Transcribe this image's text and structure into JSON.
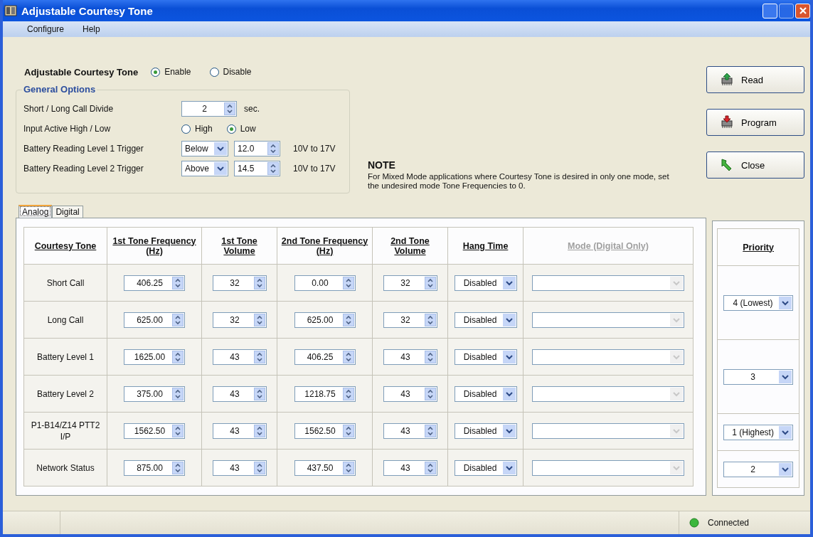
{
  "window": {
    "title": "Adjustable Courtesy Tone"
  },
  "menu": [
    "Configure",
    "Help"
  ],
  "enable": {
    "label": "Adjustable Courtesy Tone",
    "options": [
      {
        "label": "Enable",
        "selected": true
      },
      {
        "label": "Disable",
        "selected": false
      }
    ]
  },
  "general_options": {
    "title": "General Options",
    "rows": [
      {
        "kind": "spinner",
        "label": "Short / Long Call Divide",
        "value": "2",
        "unit": "sec."
      },
      {
        "kind": "radio",
        "label": "Input Active High / Low",
        "options": [
          {
            "label": "High",
            "selected": false
          },
          {
            "label": "Low",
            "selected": true
          }
        ]
      },
      {
        "kind": "trigger",
        "label": "Battery Reading Level 1 Trigger",
        "condition": "Below",
        "value": "12.0",
        "range": "10V to 17V"
      },
      {
        "kind": "trigger",
        "label": "Battery Reading Level 2 Trigger",
        "condition": "Above",
        "value": "14.5",
        "range": "10V to 17V"
      }
    ]
  },
  "note": {
    "title": "NOTE",
    "text": "For Mixed Mode applications where Courtesy Tone is desired in only one mode, set the undesired mode Tone Frequencies to 0."
  },
  "buttons": [
    {
      "kind": "read",
      "label": "Read"
    },
    {
      "kind": "program",
      "label": "Program"
    },
    {
      "kind": "close",
      "label": "Close"
    }
  ],
  "tabs": [
    {
      "label": "Analog",
      "selected": true
    },
    {
      "label": "Digital",
      "selected": false
    }
  ],
  "table": {
    "columns": [
      {
        "label": "Courtesy Tone",
        "disabled": false
      },
      {
        "label": "1st Tone Frequency (Hz)",
        "disabled": false
      },
      {
        "label": "1st Tone Volume",
        "disabled": false
      },
      {
        "label": "2nd Tone Frequency (Hz)",
        "disabled": false
      },
      {
        "label": "2nd Tone Volume",
        "disabled": false
      },
      {
        "label": "Hang Time",
        "disabled": false
      },
      {
        "label": "Mode (Digital Only)",
        "disabled": true
      }
    ],
    "rows": [
      {
        "tone": "Short Call",
        "freq_1": "406.25",
        "volume_1": "32",
        "freq_2": "0.00",
        "volume_2": "32",
        "hang_time": "Disabled",
        "mode": {
          "disabled": true
        }
      },
      {
        "tone": "Long Call",
        "freq_1": "625.00",
        "volume_1": "32",
        "freq_2": "625.00",
        "volume_2": "32",
        "hang_time": "Disabled",
        "mode": {
          "disabled": true
        }
      },
      {
        "tone": "Battery Level 1",
        "freq_1": "1625.00",
        "volume_1": "43",
        "freq_2": "406.25",
        "volume_2": "43",
        "hang_time": "Disabled",
        "mode": {
          "disabled": true
        }
      },
      {
        "tone": "Battery Level 2",
        "freq_1": "375.00",
        "volume_1": "43",
        "freq_2": "1218.75",
        "volume_2": "43",
        "hang_time": "Disabled",
        "mode": {
          "disabled": true
        }
      },
      {
        "tone": "P1-B14/Z14 PTT2 I/P",
        "freq_1": "1562.50",
        "volume_1": "43",
        "freq_2": "1562.50",
        "volume_2": "43",
        "hang_time": "Disabled",
        "mode": {
          "disabled": true
        }
      },
      {
        "tone": "Network Status",
        "freq_1": "875.00",
        "volume_1": "43",
        "freq_2": "437.50",
        "volume_2": "43",
        "hang_time": "Disabled",
        "mode": {
          "disabled": true
        }
      }
    ]
  },
  "priority": {
    "title": "Priority",
    "groups": [
      {
        "kind": "double",
        "value": "4 (Lowest)"
      },
      {
        "kind": "double",
        "value": "3"
      },
      {
        "kind": "single",
        "value": "1 (Highest)"
      },
      {
        "kind": "single",
        "value": "2"
      }
    ]
  },
  "status_bar": {
    "connection": "Connected"
  }
}
